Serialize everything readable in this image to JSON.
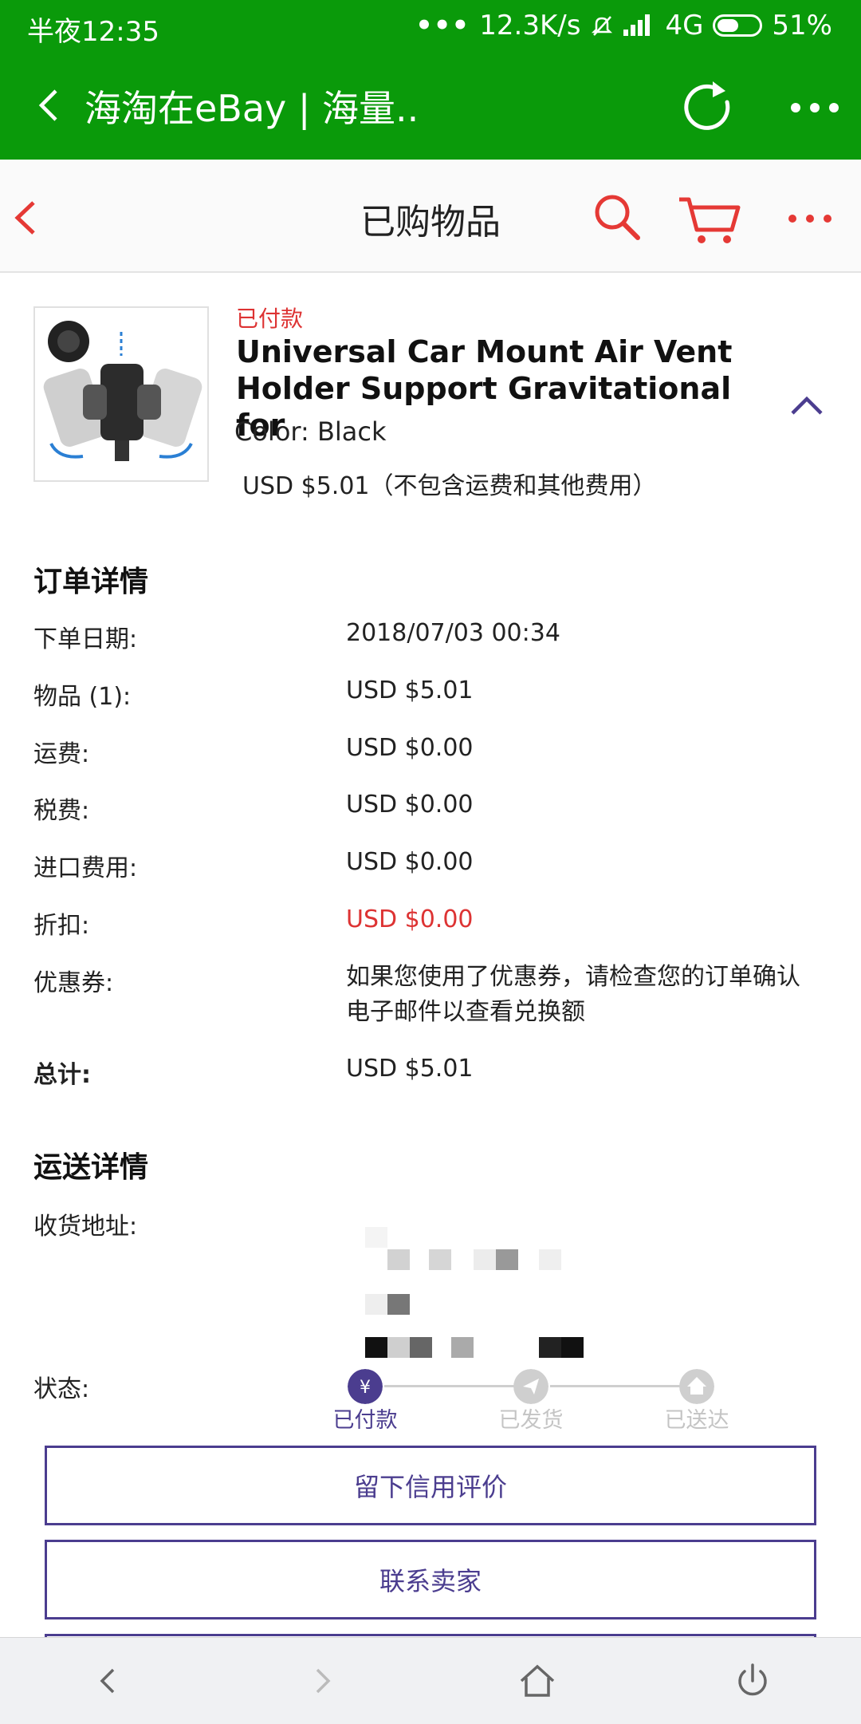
{
  "status_bar": {
    "time": "半夜12:35",
    "net_speed": "12.3K/s",
    "network": "4G",
    "battery": "51%",
    "battery_level": 0.51
  },
  "browser": {
    "title": "海淘在eBay | 海量..",
    "icons": [
      "back-icon",
      "reload-icon",
      "more-menu-icon"
    ]
  },
  "header": {
    "title": "已购物品",
    "icons": [
      "back-icon",
      "search-icon",
      "cart-icon",
      "more-dots-icon"
    ]
  },
  "product": {
    "status": "已付款",
    "title": "Universal Car Mount Air Vent Holder Support Gravitational for",
    "color": "Color: Black",
    "price": "USD $5.01（不包含运费和其他费用）"
  },
  "order_details": {
    "title": "订单详情",
    "rows": [
      {
        "label": "下单日期:",
        "value": "2018/07/03 00:34"
      },
      {
        "label": "物品 (1):",
        "value": "USD $5.01"
      },
      {
        "label": "运费:",
        "value": "USD $0.00"
      },
      {
        "label": "税费:",
        "value": "USD $0.00"
      },
      {
        "label": "进口费用:",
        "value": "USD $0.00"
      },
      {
        "label": "折扣:",
        "value": "USD $0.00"
      },
      {
        "label": "优惠券:",
        "value": "如果您使用了优惠券，请检查您的订单确认电子邮件以查看兑换额"
      },
      {
        "label": "总计:",
        "value": "USD $5.01"
      }
    ]
  },
  "shipping_details": {
    "title": "运送详情",
    "address_label": "收货地址:",
    "status_label": "状态:",
    "steps": [
      {
        "label": "已付款",
        "active": true
      },
      {
        "label": "已发货",
        "active": false
      },
      {
        "label": "已送达",
        "active": false
      }
    ]
  },
  "actions": {
    "leave_feedback": "留下信用评价",
    "contact_seller": "联系卖家"
  },
  "colors": {
    "browser_green": "#0a9a0a",
    "ebay_red": "#e53935",
    "accent_purple": "#4b3d8f",
    "inactive_gray": "#c4c4c4"
  }
}
